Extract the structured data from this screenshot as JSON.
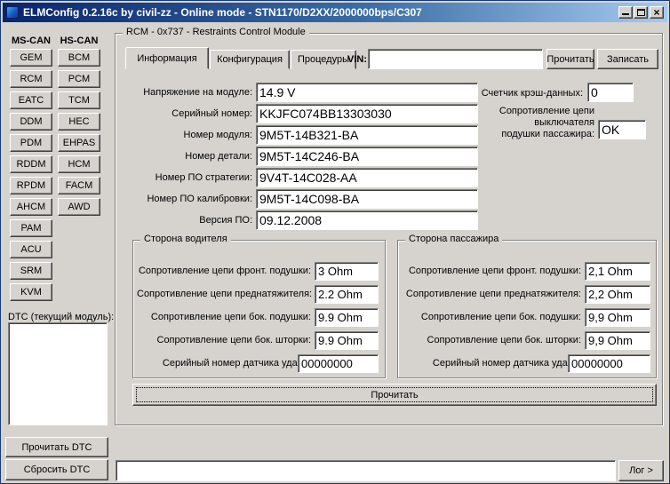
{
  "window": {
    "title": "ELMConfig 0.2.16c by civil-zz  - Online mode  - STN1170/D2XX/2000000bps/C307"
  },
  "sidebar": {
    "columns": [
      {
        "header": "MS-CAN",
        "items": [
          "GEM",
          "RCM",
          "EATC",
          "DDM",
          "PDM",
          "RDDM",
          "RPDM",
          "AHCM",
          "PAM",
          "ACU",
          "SRM",
          "KVM"
        ]
      },
      {
        "header": "HS-CAN",
        "items": [
          "BCM",
          "PCM",
          "TCM",
          "HEC",
          "EHPAS",
          "HCM",
          "FACM",
          "AWD"
        ]
      }
    ],
    "dtc_label": "DTC (текущий модуль):",
    "read_dtc_button": "Прочитать DTC",
    "clear_dtc_button": "Сбросить DTC"
  },
  "module_panel": {
    "group_title": "RCM - 0x737 - Restraints Control Module",
    "tabs": [
      {
        "label": "Информация"
      },
      {
        "label": "Конфигурация"
      },
      {
        "label": "Процедуры"
      }
    ],
    "vin": {
      "label": "VIN:",
      "value": "",
      "read_button": "Прочитать",
      "write_button": "Записать"
    },
    "info_fields": [
      {
        "label": "Напряжение на модуле:",
        "value": "14.9 V"
      },
      {
        "label": "Серийный номер:",
        "value": "KKJFC074BB13303030"
      },
      {
        "label": "Номер модуля:",
        "value": "9M5T-14B321-BA"
      },
      {
        "label": "Номер детали:",
        "value": "9M5T-14C246-BA"
      },
      {
        "label": "Номер ПО стратегии:",
        "value": "9V4T-14C028-AA"
      },
      {
        "label": "Номер ПО калибровки:",
        "value": "9M5T-14C098-BA"
      },
      {
        "label": "Версия ПО:",
        "value": "09.12.2008"
      }
    ],
    "crash_counter": {
      "label": "Счетчик крэш-данных:",
      "value": "0"
    },
    "pass_switch": {
      "label_lines": [
        "Сопротивление цепи",
        "выключателя",
        "подушки пассажира:"
      ],
      "value": "OK"
    },
    "driver_group": {
      "title": "Сторона водителя",
      "rows": [
        {
          "label": "Сопротивление цепи фронт. подушки:",
          "value": "3 Ohm"
        },
        {
          "label": "Сопротивление цепи преднатяжителя:",
          "value": "2.2 Ohm"
        },
        {
          "label": "Сопротивление цепи бок. подушки:",
          "value": "9.9 Ohm"
        },
        {
          "label": "Сопротивление цепи бок. шторки:",
          "value": "9.9 Ohm"
        },
        {
          "label": "Серийный номер датчика удара:",
          "value": "00000000"
        }
      ]
    },
    "passenger_group": {
      "title": "Сторона пассажира",
      "rows": [
        {
          "label": "Сопротивление цепи фронт. подушки:",
          "value": "2,1 Ohm"
        },
        {
          "label": "Сопротивление цепи преднатяжителя:",
          "value": "2,2 Ohm"
        },
        {
          "label": "Сопротивление цепи бок. подушки:",
          "value": "9,9 Ohm"
        },
        {
          "label": "Сопротивление цепи бок. шторки:",
          "value": "9,9 Ohm"
        },
        {
          "label": "Серийный номер датчика удара:",
          "value": "00000000"
        }
      ]
    },
    "read_all_button": "Прочитать"
  },
  "bottom_bar": {
    "log_value": "",
    "log_button": "Лог >"
  },
  "colors": {
    "titlebar_left": "#0a246a",
    "titlebar_right": "#a6caf0",
    "window_bg": "#d6d3ce"
  }
}
